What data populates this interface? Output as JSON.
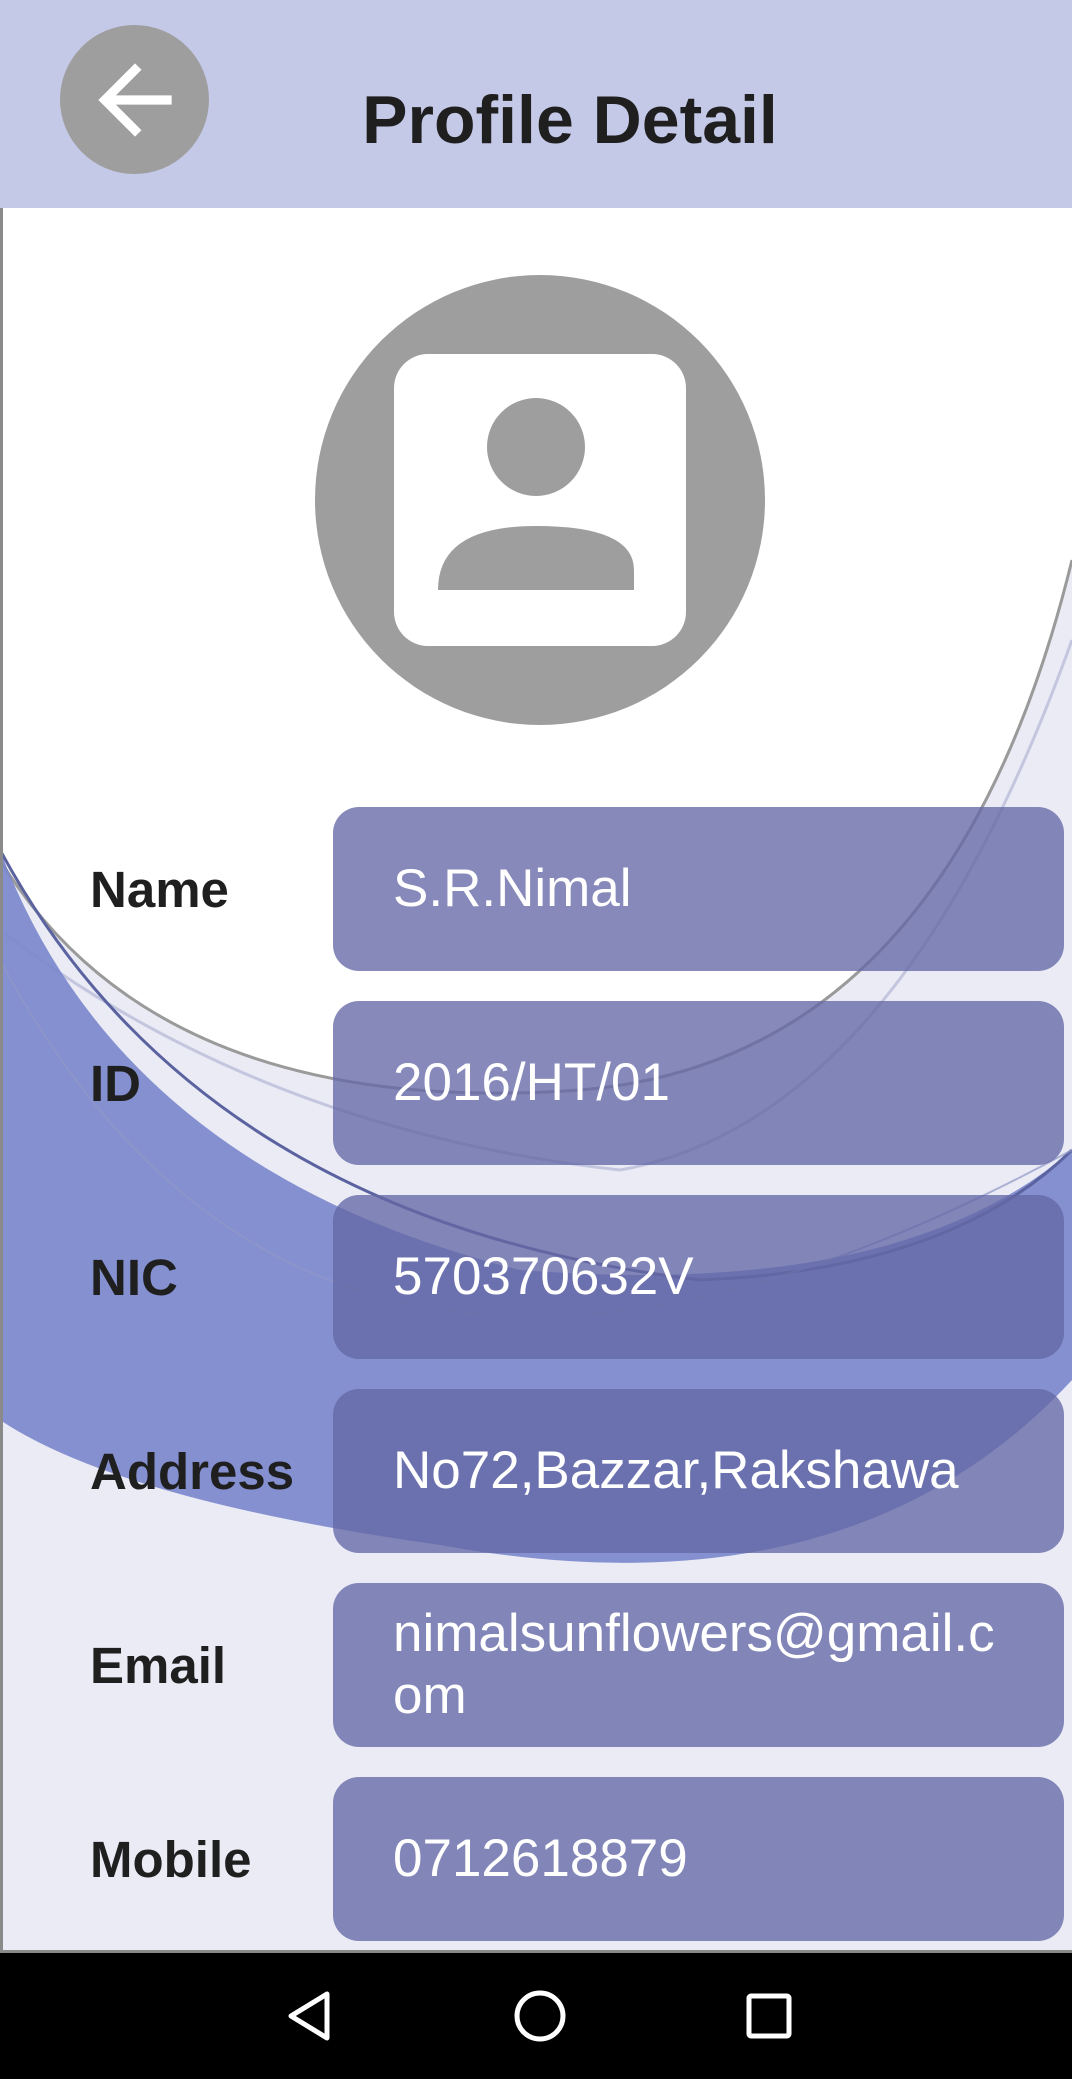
{
  "header": {
    "title": "Profile Detail",
    "back_icon": "arrow-left-icon"
  },
  "avatar": {
    "icon": "account-box-icon"
  },
  "profile": {
    "fields": [
      {
        "label": "Name",
        "value": "S.R.Nimal"
      },
      {
        "label": "ID",
        "value": "2016/HT/01"
      },
      {
        "label": "NIC",
        "value": "570370632V"
      },
      {
        "label": "Address",
        "value": "No72,Bazzar,Rakshawa"
      },
      {
        "label": "Email",
        "value": "nimalsunflowers@gmail.com"
      },
      {
        "label": "Mobile",
        "value": "0712618879"
      }
    ]
  },
  "navbar": {
    "back_icon": "triangle-back-icon",
    "home_icon": "circle-home-icon",
    "recents_icon": "square-recents-icon"
  },
  "colors": {
    "header_bg": "#c5c9e8",
    "field_bg": "#6468a5",
    "wave": "#7a86cc",
    "avatar": "#9e9e9e"
  }
}
